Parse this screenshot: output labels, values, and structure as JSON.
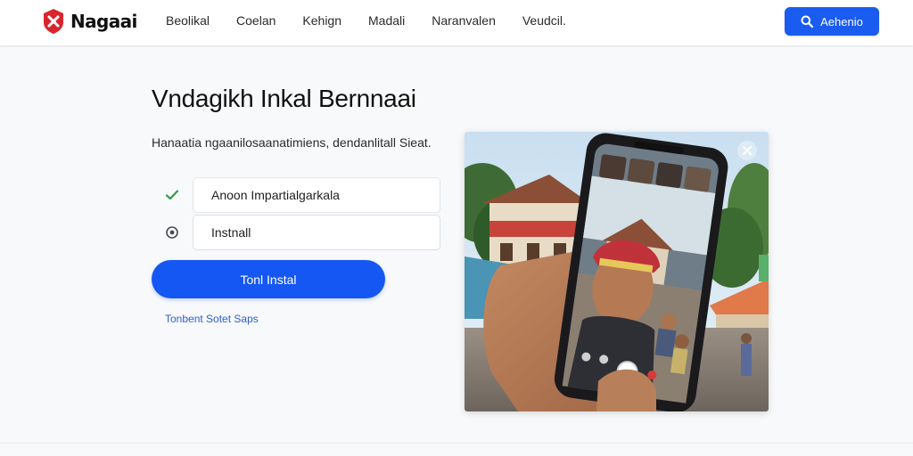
{
  "header": {
    "brand": "Nagaai",
    "nav": [
      "Beolikal",
      "Coelan",
      "Kehign",
      "Madali",
      "Naranvalen",
      "Veudcil."
    ],
    "search_label": "Aehenio"
  },
  "main": {
    "title": "Vndagikh Inkal Bernnaai",
    "description": "Hanaatia ngaanilosaanatimiens, dendanlitall Sieat.",
    "options": [
      {
        "label": "Anoon Impartialgarkala",
        "icon": "check-icon",
        "state": "checked"
      },
      {
        "label": "Instnall",
        "icon": "radio-icon",
        "state": "unselected"
      }
    ],
    "primary_button": "Tonl Instal",
    "secondary_link": "Tonbent Sotet Saps"
  },
  "colors": {
    "accent": "#1557f3",
    "brand_red": "#d8262c",
    "check_green": "#3a9a4a"
  }
}
